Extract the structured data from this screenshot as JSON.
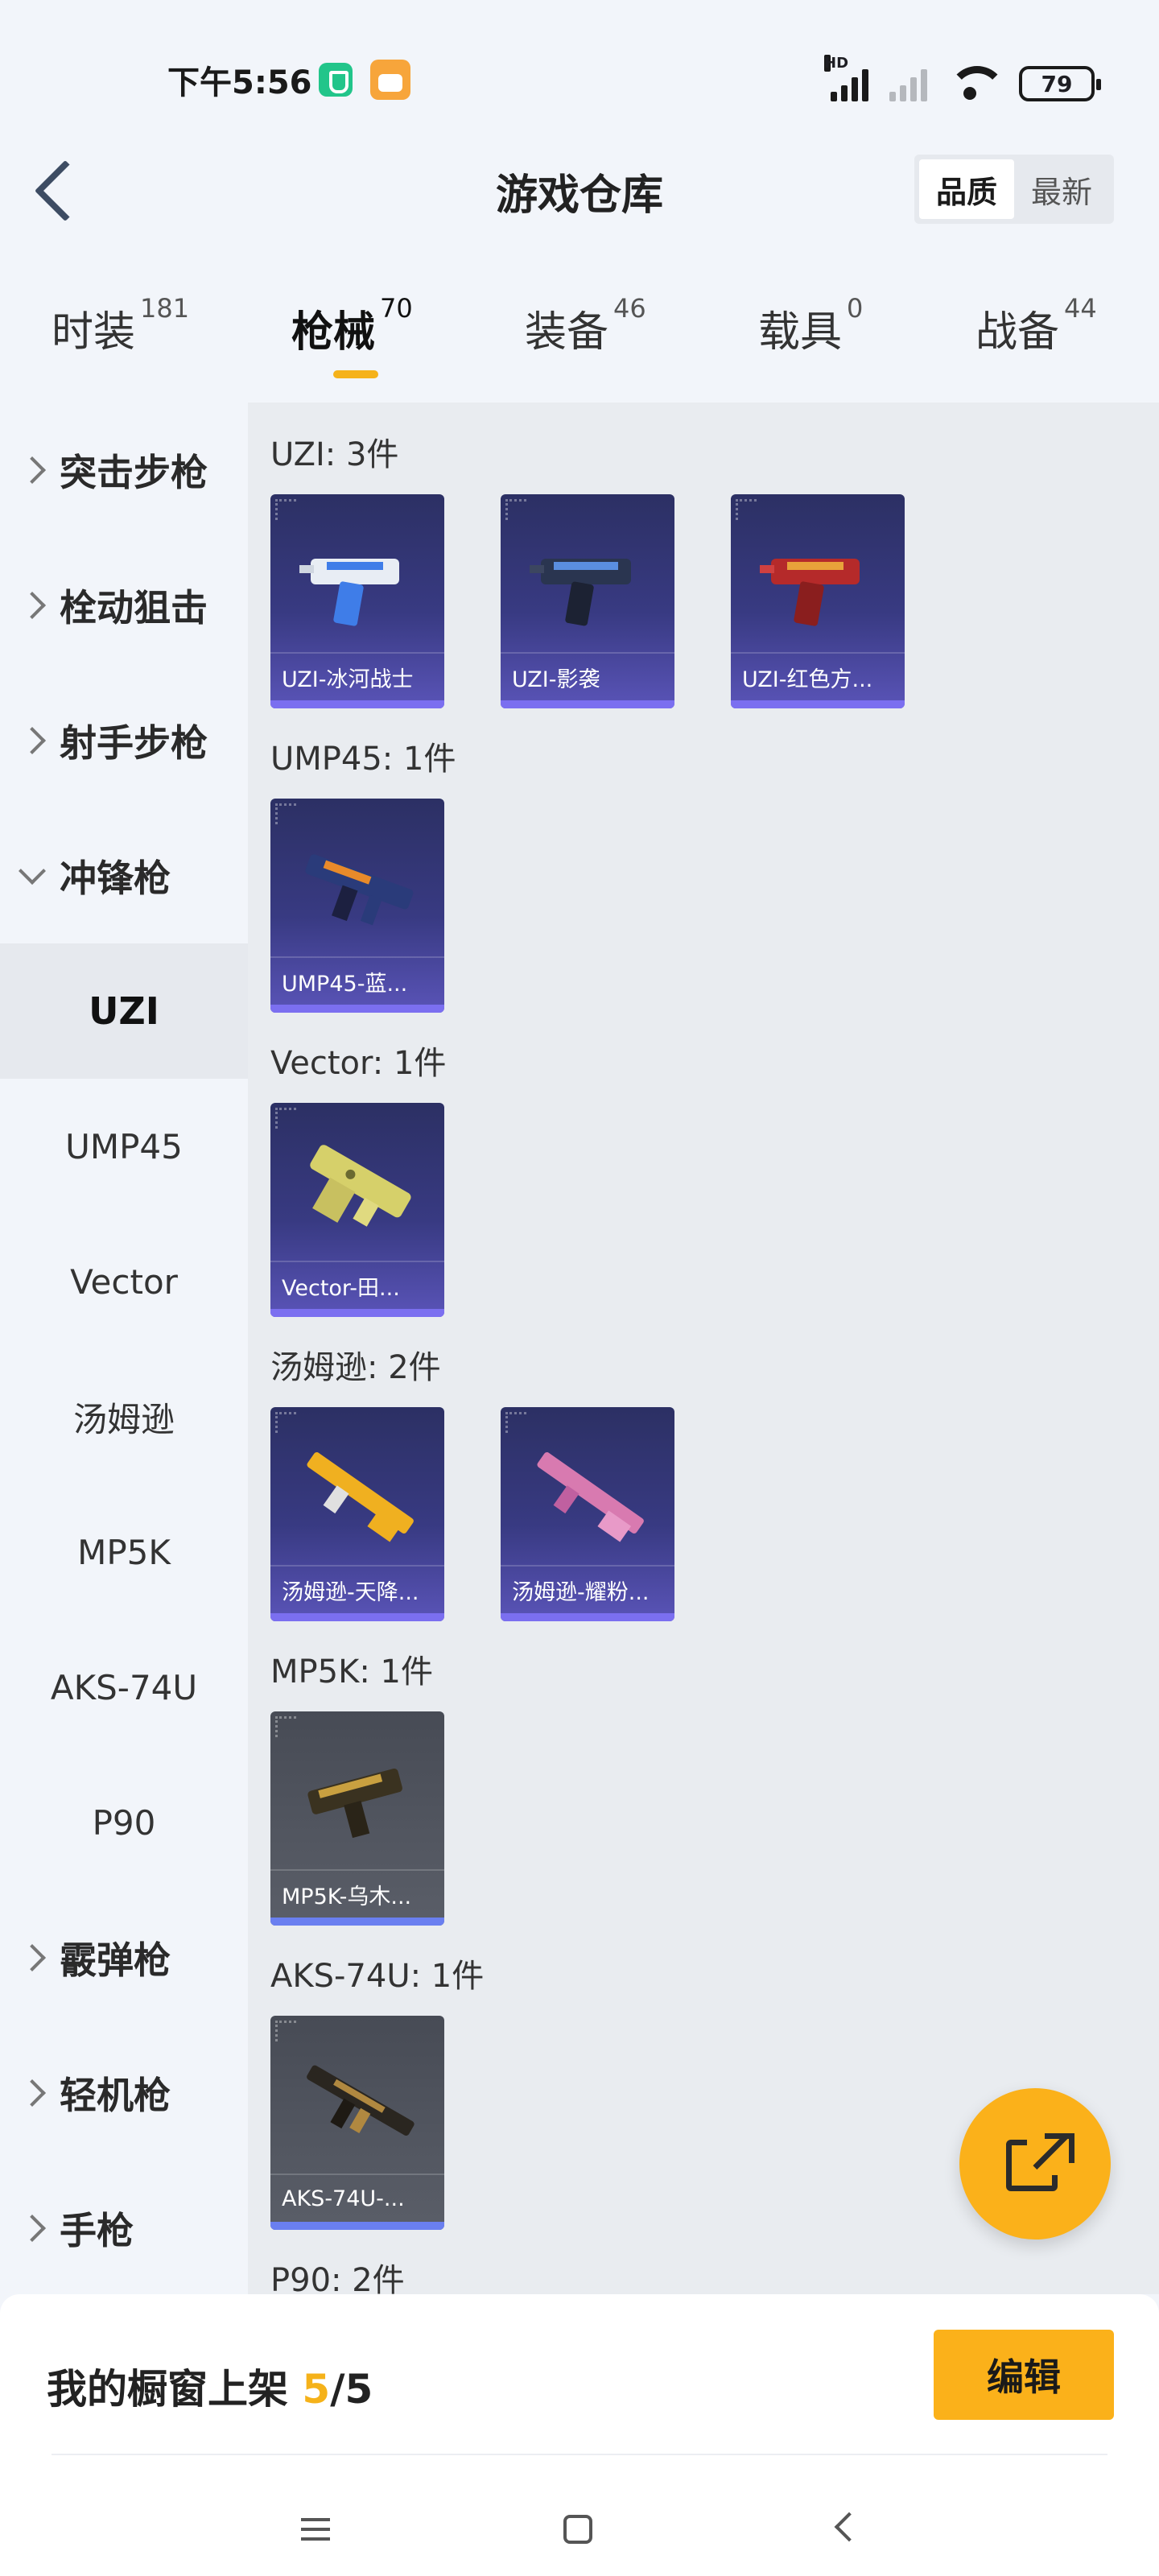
{
  "status_bar": {
    "time": "下午5:56",
    "signal_label": "HD",
    "battery": "79"
  },
  "header": {
    "title": "游戏仓库",
    "sort_options": [
      "品质",
      "最新"
    ],
    "sort_selected": "品质"
  },
  "tabs": [
    {
      "label": "时装",
      "count": "181"
    },
    {
      "label": "枪械",
      "count": "70",
      "active": true
    },
    {
      "label": "装备",
      "count": "46"
    },
    {
      "label": "载具",
      "count": "0"
    },
    {
      "label": "战备",
      "count": "44"
    }
  ],
  "sidebar": {
    "categories": [
      {
        "label": "突击步枪"
      },
      {
        "label": "栓动狙击"
      },
      {
        "label": "射手步枪"
      },
      {
        "label": "冲锋枪",
        "open": true
      },
      {
        "label": "霰弹枪"
      },
      {
        "label": "轻机枪"
      },
      {
        "label": "手枪"
      }
    ],
    "subcategories": [
      "UZI",
      "UMP45",
      "Vector",
      "汤姆逊",
      "MP5K",
      "AKS-74U",
      "P90"
    ],
    "active_sub": "UZI"
  },
  "groups": [
    {
      "title": "UZI: 3件",
      "items": [
        "UZI-冰河战士",
        "UZI-影袭",
        "UZI-红色方..."
      ]
    },
    {
      "title": "UMP45: 1件",
      "items": [
        "UMP45-蓝..."
      ]
    },
    {
      "title": "Vector: 1件",
      "items": [
        "Vector-田..."
      ]
    },
    {
      "title": "汤姆逊: 2件",
      "items": [
        "汤姆逊-天降...",
        "汤姆逊-耀粉..."
      ]
    },
    {
      "title": "MP5K: 1件",
      "items": [
        "MP5K-乌木..."
      ]
    },
    {
      "title": "AKS-74U: 1件",
      "items": [
        "AKS-74U-..."
      ]
    },
    {
      "title": "P90: 2件",
      "items": []
    }
  ],
  "showcase": {
    "label": "我的橱窗上架",
    "current": "5",
    "separator": "/",
    "total": "5",
    "edit_label": "编辑"
  },
  "colors": {
    "accent": "#fbb11a",
    "card_purple": "#383a82",
    "card_gray": "#5a5e68",
    "card_bar": "#7b6ff0"
  },
  "icons": [
    "back-arrow-icon",
    "share-icon",
    "chevron-right-icon",
    "chevron-down-icon",
    "menu-icon",
    "home-icon",
    "back-icon"
  ]
}
